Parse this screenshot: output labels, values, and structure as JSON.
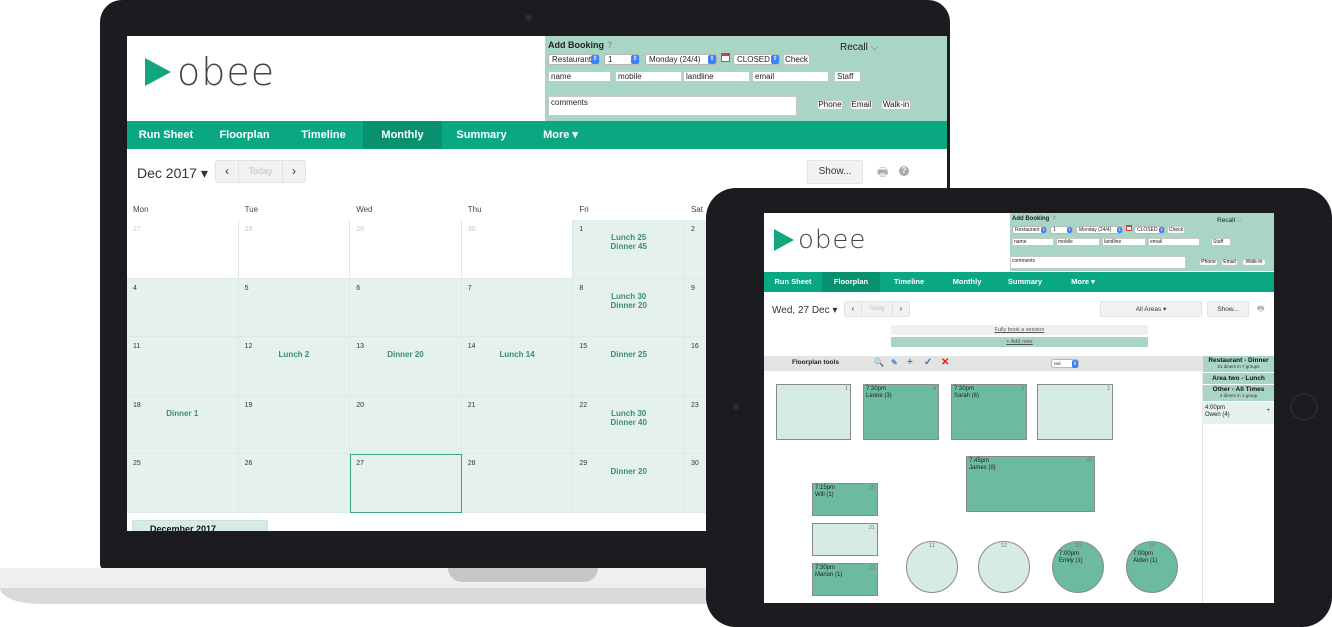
{
  "laptop": {
    "app": {
      "logo": {
        "text": "obee",
        "icon": "paper-plane-icon"
      },
      "add_booking": {
        "title": "Add Booking",
        "help": "?",
        "area_select": "Restaurant",
        "party_select": "1",
        "day_select": "Monday (24/4)",
        "session_select": "CLOSED",
        "check_label": "Check",
        "recall_label": "Recall",
        "name_placeholder": "name",
        "mobile_placeholder": "mobile",
        "landline_placeholder": "landline",
        "email_placeholder": "email",
        "staff_placeholder": "Staff",
        "comments_placeholder": "comments",
        "phone_label": "Phone",
        "email_label": "Email",
        "walkin_label": "Walk-in"
      },
      "nav": [
        {
          "label": "Run Sheet",
          "active": false
        },
        {
          "label": "Floorplan",
          "active": false
        },
        {
          "label": "Timeline",
          "active": false
        },
        {
          "label": "Monthly",
          "active": true
        },
        {
          "label": "Summary",
          "active": false
        },
        {
          "label": "More ▾",
          "active": false
        }
      ],
      "toolbar": {
        "month": "Dec 2017 ▾",
        "prev": "‹",
        "today": "Today",
        "next": "›",
        "show": "Show...",
        "print_icon": "print-icon",
        "help_icon": "help-icon"
      },
      "calendar": {
        "weekdays": [
          "Mon",
          "Tue",
          "Wed",
          "Thu",
          "Fri",
          "Sat"
        ],
        "weeks": [
          [
            {
              "day": "27",
              "other": true,
              "events": []
            },
            {
              "day": "28",
              "other": true,
              "events": []
            },
            {
              "day": "29",
              "other": true,
              "events": []
            },
            {
              "day": "30",
              "other": true,
              "events": []
            },
            {
              "day": "1",
              "events": [
                "Lunch 25",
                "Dinner 45"
              ]
            },
            {
              "day": "2",
              "events": []
            }
          ],
          [
            {
              "day": "4",
              "events": []
            },
            {
              "day": "5",
              "events": []
            },
            {
              "day": "6",
              "events": []
            },
            {
              "day": "7",
              "events": []
            },
            {
              "day": "8",
              "events": [
                "Lunch 30",
                "Dinner 20"
              ]
            },
            {
              "day": "9",
              "events": []
            }
          ],
          [
            {
              "day": "11",
              "events": []
            },
            {
              "day": "12",
              "events": [
                "Lunch 2"
              ]
            },
            {
              "day": "13",
              "events": [
                "Dinner 20"
              ]
            },
            {
              "day": "14",
              "events": [
                "Lunch 14"
              ]
            },
            {
              "day": "15",
              "events": [
                "Dinner 25"
              ]
            },
            {
              "day": "16",
              "events": []
            }
          ],
          [
            {
              "day": "18",
              "events": [
                "Dinner 1"
              ]
            },
            {
              "day": "19",
              "events": []
            },
            {
              "day": "20",
              "events": []
            },
            {
              "day": "21",
              "events": []
            },
            {
              "day": "22",
              "events": [
                "Lunch 30",
                "Dinner 40"
              ]
            },
            {
              "day": "23",
              "events": []
            }
          ],
          [
            {
              "day": "25",
              "events": []
            },
            {
              "day": "26",
              "events": []
            },
            {
              "day": "27",
              "selected": true,
              "events": []
            },
            {
              "day": "28",
              "events": []
            },
            {
              "day": "29",
              "events": [
                "Dinner 20"
              ]
            },
            {
              "day": "30",
              "events": []
            }
          ]
        ],
        "mini_month": "December 2017"
      }
    }
  },
  "tablet": {
    "app": {
      "logo": {
        "text": "obee",
        "icon": "paper-plane-icon"
      },
      "add_booking": {
        "title": "Add Booking",
        "help": "?",
        "area_select": "Restaurant",
        "party_select": "1",
        "day_select": "Monday (24/4)",
        "session_select": "CLOSED",
        "check_label": "Check",
        "recall_label": "Recall",
        "name_placeholder": "name",
        "mobile_placeholder": "mobile",
        "landline_placeholder": "landline",
        "email_placeholder": "email",
        "staff_placeholder": "Staff",
        "comments_placeholder": "comments",
        "phone_label": "Phone",
        "email_label": "Email",
        "walkin_label": "Walk-in"
      },
      "nav": [
        {
          "label": "Run Sheet",
          "active": false
        },
        {
          "label": "Floorplan",
          "active": true
        },
        {
          "label": "Timeline",
          "active": false
        },
        {
          "label": "Monthly",
          "active": false
        },
        {
          "label": "Summary",
          "active": false
        },
        {
          "label": "More ▾",
          "active": false
        }
      ],
      "toolbar": {
        "date": "Wed, 27 Dec ▾",
        "prev": "‹",
        "today": "Today",
        "next": "›",
        "areas": "All Areas ▾",
        "show": "Show...",
        "print_icon": "print-icon"
      },
      "fully_book": "Fully book a session",
      "add_note": "+ Add note",
      "floorplan_tools": {
        "label": "Floorplan tools",
        "icons": [
          "zoom-icon",
          "pencil-icon",
          "add-icon",
          "check-icon",
          "delete-icon"
        ],
        "color_select": "red"
      },
      "sidebar": {
        "sessions": [
          {
            "title": "Restaurant - Dinner",
            "subtitle": "21 diners in 7 groups"
          },
          {
            "title": "Area two - Lunch",
            "subtitle": ""
          },
          {
            "title": "Other - All Times",
            "subtitle": "4 diners in 1 group"
          }
        ],
        "bookings": [
          {
            "time": "4:00pm",
            "name": "Owen (4)",
            "action": "+"
          }
        ]
      },
      "tables": [
        {
          "number": "1",
          "status": "free",
          "shape": "rect",
          "time": "",
          "guest": ""
        },
        {
          "number": "4",
          "status": "busy",
          "shape": "rect",
          "time": "7:30pm",
          "guest": "Leone (3)"
        },
        {
          "number": "3",
          "status": "busy",
          "shape": "rect",
          "time": "7:30pm",
          "guest": "Sarah (6)"
        },
        {
          "number": "2",
          "status": "free",
          "shape": "rect",
          "time": "",
          "guest": ""
        },
        {
          "number": "30",
          "status": "busy",
          "shape": "rect",
          "time": "7:45pm",
          "guest": "James (8)"
        },
        {
          "number": "20",
          "status": "busy",
          "shape": "rect",
          "time": "7:15pm",
          "guest": "Will (1)"
        },
        {
          "number": "21",
          "status": "free",
          "shape": "rect",
          "time": "",
          "guest": ""
        },
        {
          "number": "22",
          "status": "busy",
          "shape": "rect",
          "time": "7:30pm",
          "guest": "Marion (1)"
        },
        {
          "number": "11",
          "status": "free",
          "shape": "round",
          "time": "",
          "guest": ""
        },
        {
          "number": "12",
          "status": "free",
          "shape": "round",
          "time": "",
          "guest": ""
        },
        {
          "number": "13",
          "status": "busy",
          "shape": "round",
          "time": "7:00pm",
          "guest": "Emily (1)"
        },
        {
          "number": "14",
          "status": "busy",
          "shape": "round",
          "time": "7:00pm",
          "guest": "Aiden (1)"
        }
      ]
    }
  }
}
